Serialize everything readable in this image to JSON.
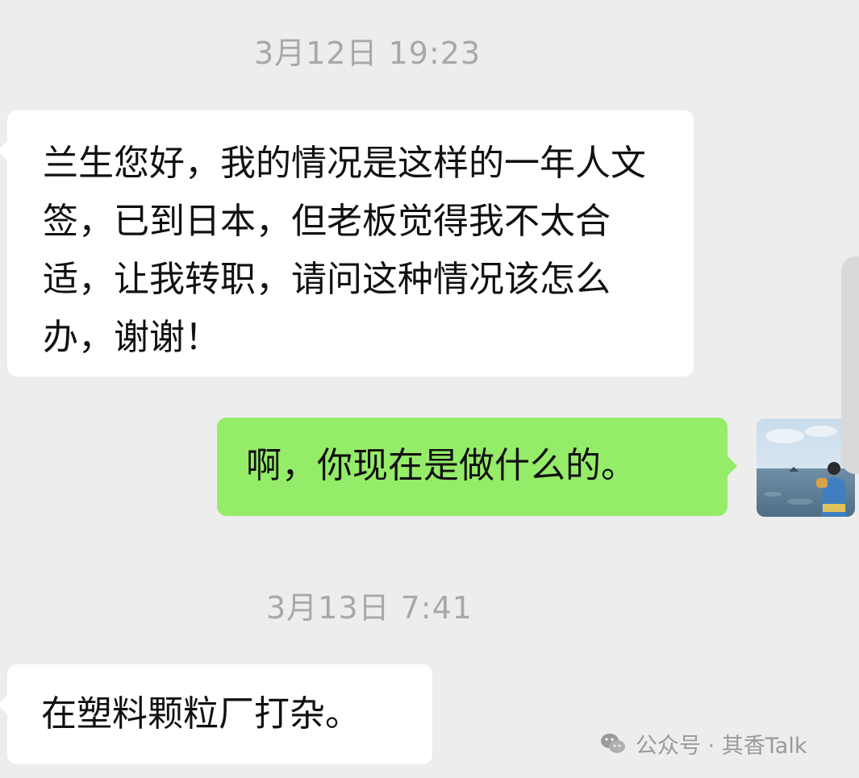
{
  "chat": {
    "timestamps": [
      "3月12日 19:23",
      "3月13日 7:41"
    ],
    "messages": [
      {
        "sender": "other",
        "text": "兰生您好，我的情况是这样的一年人文签，已到日本，但老板觉得我不太合适，让我转职，请问这种情况该怎么办，谢谢！"
      },
      {
        "sender": "self",
        "text": "啊，你现在是做什么的。"
      },
      {
        "sender": "other",
        "text": "在塑料颗粒厂打杂。"
      }
    ]
  },
  "avatar": {
    "icon": "user-avatar-photo"
  },
  "watermark": {
    "text": "公众号 · 其香Talk",
    "icon": "wechat-logo-icon"
  },
  "colors": {
    "background": "#ededed",
    "incoming_bubble": "#ffffff",
    "outgoing_bubble": "#95ec69",
    "timestamp_text": "#a8a8a8"
  }
}
